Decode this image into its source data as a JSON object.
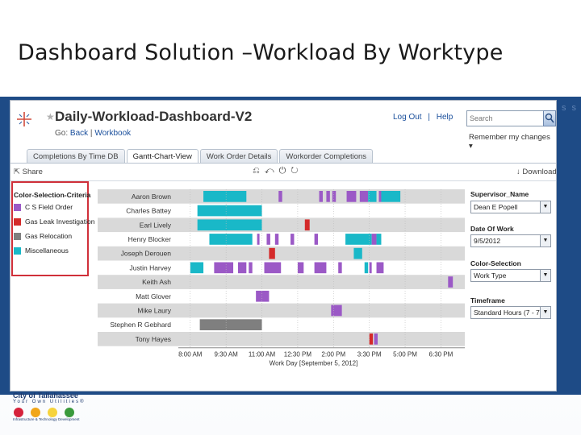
{
  "slide": {
    "title": "Dashboard Solution –Workload By Worktype",
    "band_word": "s s"
  },
  "header": {
    "title": "Daily-Workload-Dashboard-V2",
    "go_label": "Go:",
    "back_label": "Back",
    "separator": "|",
    "workbook_label": "Workbook",
    "logout_label": "Log Out",
    "help_label": "Help",
    "search_placeholder": "Search",
    "remember_label": "Remember my changes ▾"
  },
  "tabs": [
    {
      "label": "Completions By Time DB"
    },
    {
      "label": "Gantt-Chart-View"
    },
    {
      "label": "Work Order Details"
    },
    {
      "label": "Workorder Completions"
    }
  ],
  "toolbar": {
    "share_label": "Share",
    "download_label": "Download"
  },
  "legend": {
    "title": "Color-Selection-Criteria",
    "items": [
      {
        "label": "C S Field Order",
        "color": "#9b59c6"
      },
      {
        "label": "Gas Leak Investigation",
        "color": "#d42a2a"
      },
      {
        "label": "Gas Relocation",
        "color": "#7f7f7f"
      },
      {
        "label": "Miscellaneous",
        "color": "#19b8c8"
      }
    ]
  },
  "chart_data": {
    "type": "gantt",
    "x_axis_label": "Work Day [September 5, 2012]",
    "x_ticks": [
      "8:00 AM",
      "9:30 AM",
      "11:00 AM",
      "12:30 PM",
      "2:00 PM",
      "3:30 PM",
      "5:00 PM",
      "6:30 PM"
    ],
    "x_range_hours": [
      7.5,
      19.5
    ],
    "colors": {
      "C S Field Order": "#9b59c6",
      "Gas Leak Investigation": "#d42a2a",
      "Gas Relocation": "#7f7f7f",
      "Miscellaneous": "#19b8c8"
    },
    "rows": [
      {
        "name": "Aaron Brown",
        "tasks": [
          {
            "start": 8.55,
            "end": 10.35,
            "type": "Miscellaneous"
          },
          {
            "start": 11.7,
            "end": 11.85,
            "type": "C S Field Order"
          },
          {
            "start": 13.4,
            "end": 13.55,
            "type": "C S Field Order"
          },
          {
            "start": 13.7,
            "end": 13.85,
            "type": "C S Field Order"
          },
          {
            "start": 13.95,
            "end": 14.1,
            "type": "C S Field Order"
          },
          {
            "start": 14.55,
            "end": 14.95,
            "type": "C S Field Order"
          },
          {
            "start": 15.1,
            "end": 15.45,
            "type": "C S Field Order"
          },
          {
            "start": 15.45,
            "end": 15.8,
            "type": "Miscellaneous"
          },
          {
            "start": 15.9,
            "end": 16.0,
            "type": "C S Field Order"
          },
          {
            "start": 16.0,
            "end": 16.8,
            "type": "Miscellaneous"
          }
        ]
      },
      {
        "name": "Charles Battey",
        "tasks": [
          {
            "start": 8.3,
            "end": 11.0,
            "type": "Miscellaneous"
          }
        ]
      },
      {
        "name": "Earl Lively",
        "tasks": [
          {
            "start": 8.3,
            "end": 11.0,
            "type": "Miscellaneous"
          },
          {
            "start": 12.8,
            "end": 13.0,
            "type": "Gas Leak Investigation"
          }
        ]
      },
      {
        "name": "Henry Blocker",
        "tasks": [
          {
            "start": 8.8,
            "end": 10.6,
            "type": "Miscellaneous"
          },
          {
            "start": 10.8,
            "end": 10.9,
            "type": "C S Field Order"
          },
          {
            "start": 11.2,
            "end": 11.35,
            "type": "C S Field Order"
          },
          {
            "start": 11.55,
            "end": 11.7,
            "type": "C S Field Order"
          },
          {
            "start": 12.2,
            "end": 12.35,
            "type": "C S Field Order"
          },
          {
            "start": 13.2,
            "end": 13.35,
            "type": "C S Field Order"
          },
          {
            "start": 14.5,
            "end": 15.6,
            "type": "Miscellaneous"
          },
          {
            "start": 15.6,
            "end": 15.8,
            "type": "C S Field Order"
          },
          {
            "start": 15.8,
            "end": 16.0,
            "type": "Miscellaneous"
          }
        ]
      },
      {
        "name": "Joseph Derouen",
        "tasks": [
          {
            "start": 11.3,
            "end": 11.55,
            "type": "Gas Leak Investigation"
          },
          {
            "start": 14.85,
            "end": 15.2,
            "type": "Miscellaneous"
          }
        ]
      },
      {
        "name": "Justin Harvey",
        "tasks": [
          {
            "start": 8.0,
            "end": 8.55,
            "type": "Miscellaneous"
          },
          {
            "start": 9.0,
            "end": 9.8,
            "type": "C S Field Order"
          },
          {
            "start": 10.0,
            "end": 10.35,
            "type": "C S Field Order"
          },
          {
            "start": 10.45,
            "end": 10.6,
            "type": "C S Field Order"
          },
          {
            "start": 11.1,
            "end": 11.8,
            "type": "C S Field Order"
          },
          {
            "start": 12.5,
            "end": 12.75,
            "type": "C S Field Order"
          },
          {
            "start": 13.2,
            "end": 13.7,
            "type": "C S Field Order"
          },
          {
            "start": 14.2,
            "end": 14.35,
            "type": "C S Field Order"
          },
          {
            "start": 15.3,
            "end": 15.45,
            "type": "Miscellaneous"
          },
          {
            "start": 15.5,
            "end": 15.6,
            "type": "C S Field Order"
          },
          {
            "start": 15.8,
            "end": 16.1,
            "type": "C S Field Order"
          }
        ]
      },
      {
        "name": "Keith Ash",
        "tasks": [
          {
            "start": 18.8,
            "end": 19.0,
            "type": "C S Field Order"
          }
        ]
      },
      {
        "name": "Matt Glover",
        "tasks": [
          {
            "start": 10.75,
            "end": 11.3,
            "type": "C S Field Order"
          }
        ]
      },
      {
        "name": "Mike Laury",
        "tasks": [
          {
            "start": 13.9,
            "end": 14.35,
            "type": "C S Field Order"
          }
        ]
      },
      {
        "name": "Stephen R Gebhard",
        "tasks": [
          {
            "start": 8.4,
            "end": 11.0,
            "type": "Gas Relocation"
          }
        ]
      },
      {
        "name": "Tony Hayes",
        "tasks": [
          {
            "start": 15.5,
            "end": 15.65,
            "type": "Gas Leak Investigation"
          },
          {
            "start": 15.7,
            "end": 15.85,
            "type": "C S Field Order"
          }
        ]
      }
    ]
  },
  "filters": {
    "supervisor_label": "Supervisor_Name",
    "supervisor_value": "Dean E Popell",
    "date_label": "Date Of Work",
    "date_value": "9/5/2012",
    "color_label": "Color-Selection",
    "color_value": "Work Type",
    "timeframe_label": "Timeframe",
    "timeframe_value": "Standard Hours (7 - 7)"
  },
  "footer": {
    "city": "City of Tallahassee",
    "tagline": "Your Own Utilities®",
    "dept": "Infrastructure & Technology Development"
  }
}
